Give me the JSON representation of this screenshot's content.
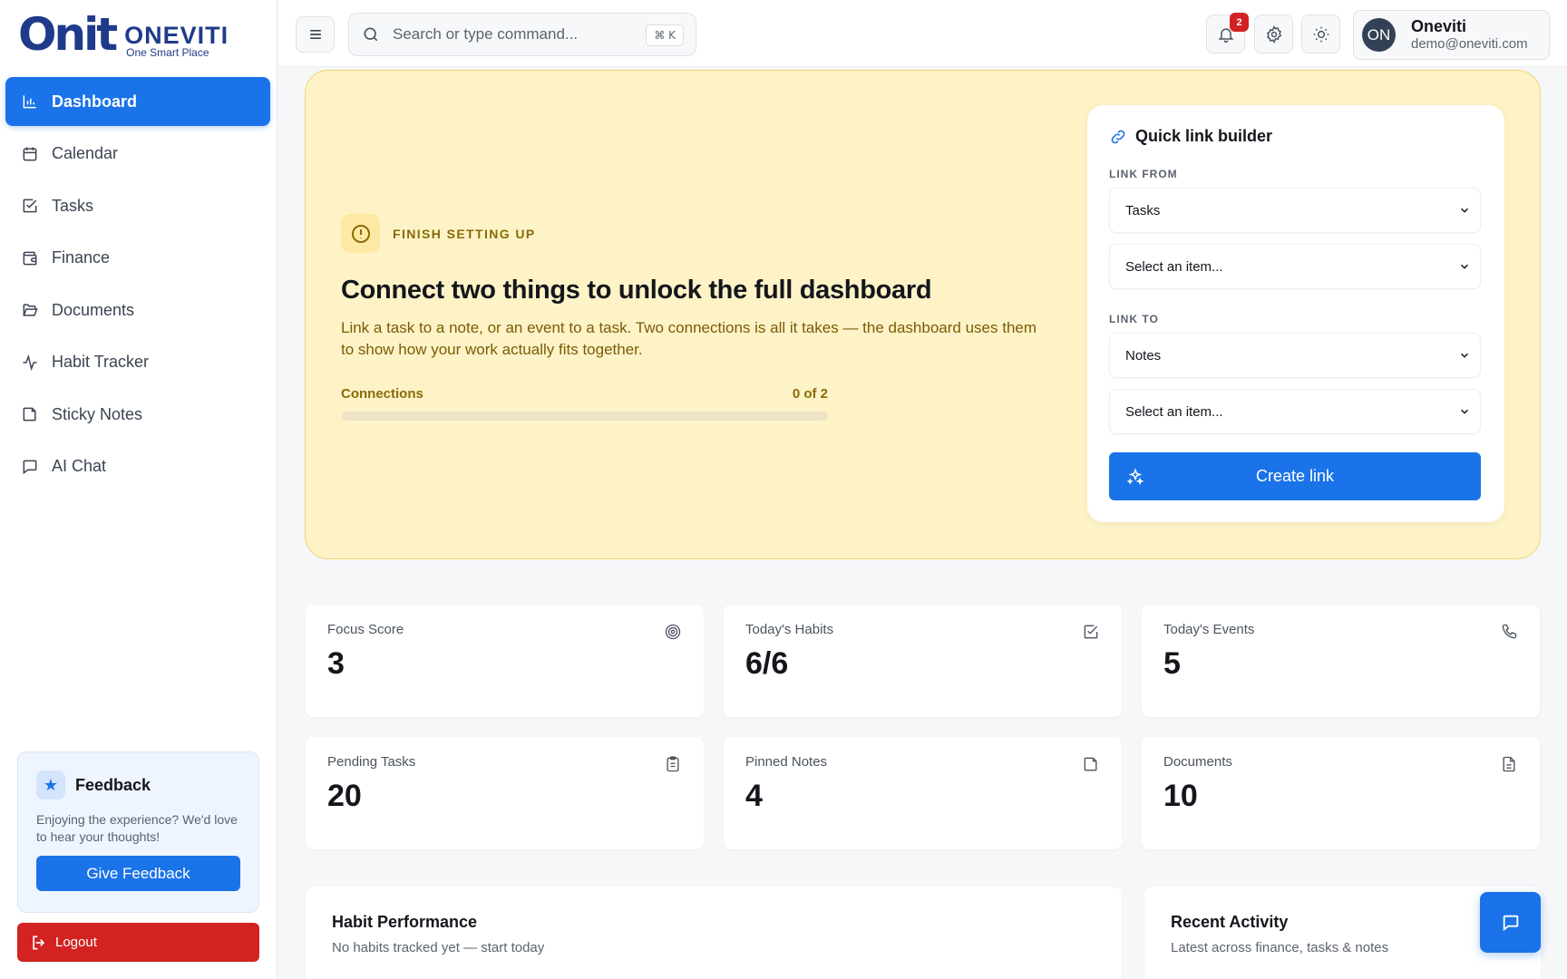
{
  "brand": {
    "logo_mark": "Onit",
    "name": "ONEVITI",
    "tagline": "One Smart Place"
  },
  "sidebar": {
    "items": [
      {
        "label": "Dashboard",
        "icon": "bar-chart-icon",
        "active": true
      },
      {
        "label": "Calendar",
        "icon": "calendar-icon"
      },
      {
        "label": "Tasks",
        "icon": "checkbox-icon"
      },
      {
        "label": "Finance",
        "icon": "wallet-icon"
      },
      {
        "label": "Documents",
        "icon": "folder-icon"
      },
      {
        "label": "Habit Tracker",
        "icon": "activity-icon"
      },
      {
        "label": "Sticky Notes",
        "icon": "sticky-note-icon"
      },
      {
        "label": "AI Chat",
        "icon": "message-icon"
      }
    ],
    "feedback": {
      "title": "Feedback",
      "text": "Enjoying the experience? We'd love to hear your thoughts!",
      "button": "Give Feedback"
    },
    "logout": "Logout"
  },
  "topbar": {
    "search_placeholder": "Search or type command...",
    "shortcut": "⌘ K",
    "notifications_count": "2",
    "user": {
      "initials": "ON",
      "name": "Oneviti",
      "email": "demo@oneviti.com"
    }
  },
  "setup": {
    "kicker": "FINISH SETTING UP",
    "title": "Connect two things to unlock the full dashboard",
    "description": "Link a task to a note, or an event to a task. Two connections is all it takes — the dashboard uses them to show how your work actually fits together.",
    "progress_label": "Connections",
    "progress_text": "0 of 2",
    "progress_value": 0
  },
  "quick_link": {
    "title": "Quick link builder",
    "from_label": "LINK FROM",
    "from_type": "Tasks",
    "from_item": "Select an item...",
    "to_label": "LINK TO",
    "to_type": "Notes",
    "to_item": "Select an item...",
    "button": "Create link"
  },
  "stats": [
    {
      "label": "Focus Score",
      "value": "3",
      "icon": "target-icon"
    },
    {
      "label": "Today's Habits",
      "value": "6/6",
      "icon": "check-square-icon"
    },
    {
      "label": "Today's Events",
      "value": "5",
      "icon": "phone-icon"
    },
    {
      "label": "Pending Tasks",
      "value": "20",
      "icon": "clipboard-icon"
    },
    {
      "label": "Pinned Notes",
      "value": "4",
      "icon": "note-icon"
    },
    {
      "label": "Documents",
      "value": "10",
      "icon": "file-text-icon"
    }
  ],
  "panels": {
    "habit": {
      "title": "Habit Performance",
      "subtitle": "No habits tracked yet — start today"
    },
    "activity": {
      "title": "Recent Activity",
      "subtitle": "Latest across finance, tasks & notes"
    }
  },
  "colors": {
    "accent": "#1a73e8",
    "danger": "#d32222",
    "banner_bg": "#fef3c7",
    "banner_border": "#f3d674",
    "brand": "#1e3a8a"
  }
}
